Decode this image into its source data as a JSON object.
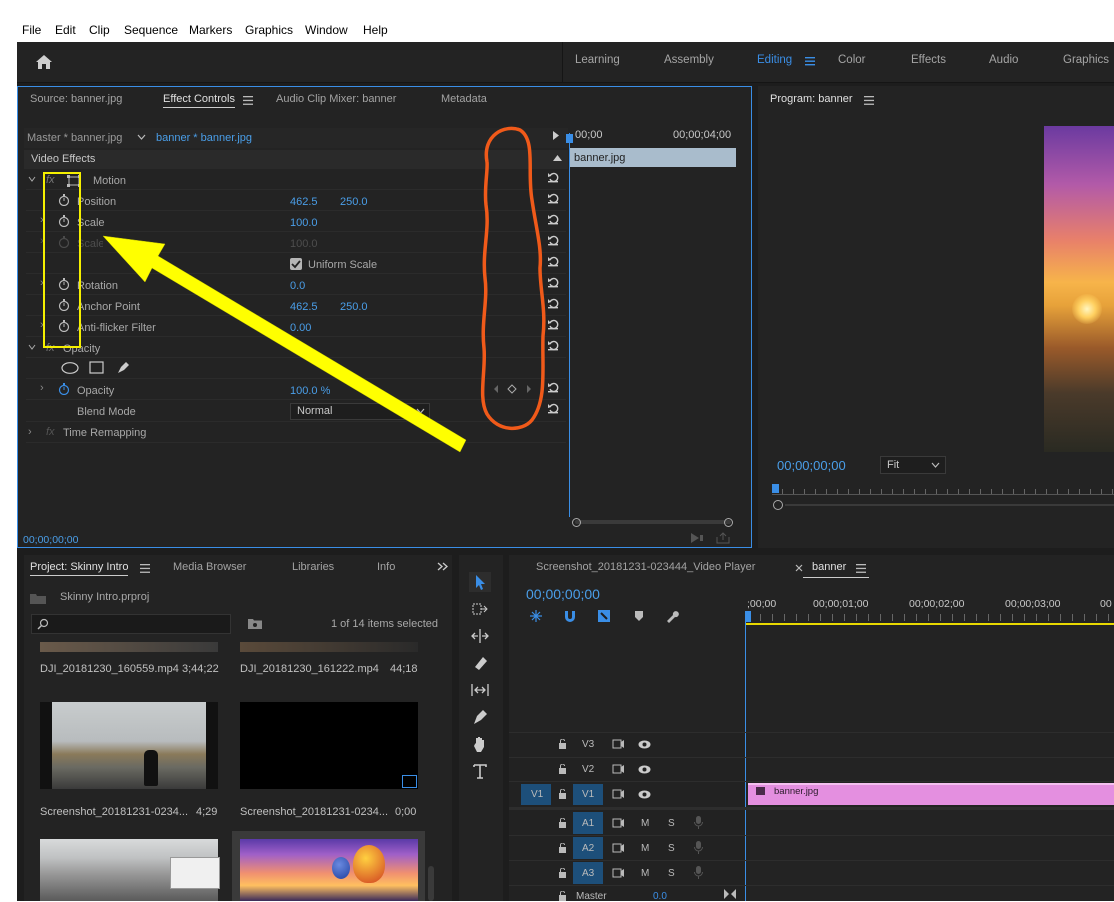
{
  "menu": [
    "File",
    "Edit",
    "Clip",
    "Sequence",
    "Markers",
    "Graphics",
    "Window",
    "Help"
  ],
  "workspaces": {
    "items": [
      {
        "label": "Learning",
        "active": false
      },
      {
        "label": "Assembly",
        "active": false
      },
      {
        "label": "Editing",
        "active": true
      },
      {
        "label": "Color",
        "active": false
      },
      {
        "label": "Effects",
        "active": false
      },
      {
        "label": "Audio",
        "active": false
      },
      {
        "label": "Graphics",
        "active": false
      }
    ]
  },
  "source_tabs": {
    "source": "Source: banner.jpg",
    "effect_controls": "Effect Controls",
    "mixer": "Audio Clip Mixer: banner",
    "metadata": "Metadata"
  },
  "effect_controls": {
    "master": "Master * banner.jpg",
    "clip": "banner * banner.jpg",
    "time_start": "00;00",
    "time_end": "00;00;04;00",
    "clip_bar": "banner.jpg",
    "section": "Video Effects",
    "motion": "Motion",
    "position": {
      "label": "Position",
      "x": "462.5",
      "y": "250.0"
    },
    "scale": {
      "label": "Scale",
      "value": "100.0"
    },
    "scale_width": {
      "label": "Scale Width",
      "value": "100.0"
    },
    "uniform_scale": "Uniform Scale",
    "rotation": {
      "label": "Rotation",
      "value": "0.0"
    },
    "anchor": {
      "label": "Anchor Point",
      "x": "462.5",
      "y": "250.0"
    },
    "antiflicker": {
      "label": "Anti-flicker Filter",
      "value": "0.00"
    },
    "opacity_group": "Opacity",
    "opacity": {
      "label": "Opacity",
      "value": "100.0 %"
    },
    "blend": {
      "label": "Blend Mode",
      "value": "Normal"
    },
    "time_remap": "Time Remapping",
    "timecode": "00;00;00;00"
  },
  "program": {
    "title": "Program: banner",
    "timecode": "00;00;00;00",
    "fit": "Fit"
  },
  "project": {
    "tabs": {
      "project": "Project: Skinny Intro",
      "media": "Media Browser",
      "libraries": "Libraries",
      "info": "Info"
    },
    "file": "Skinny Intro.prproj",
    "selected": "1 of 14 items selected",
    "items": [
      {
        "name": "DJI_20181230_160559.mp4",
        "dur": "3;44;22"
      },
      {
        "name": "DJI_20181230_161222.mp4",
        "dur": "44;18"
      },
      {
        "name": "Screenshot_20181231-0234...",
        "dur": "4;29"
      },
      {
        "name": "Screenshot_20181231-0234...",
        "dur": "0;00"
      }
    ]
  },
  "timeline": {
    "tab1": "Screenshot_20181231-023444_Video Player",
    "tab2": "banner",
    "timecode": "00;00;00;00",
    "ruler": [
      ";00;00",
      "00;00;01;00",
      "00;00;02;00",
      "00;00;03;00",
      "00"
    ],
    "tracks": {
      "v3": "V3",
      "v2": "V2",
      "v1": "V1",
      "src_v1": "V1",
      "a1": "A1",
      "a2": "A2",
      "a3": "A3",
      "m": "M",
      "s": "S",
      "master": "Master",
      "master_val": "0.0"
    },
    "clip": "banner.jpg"
  },
  "colors": {
    "accent": "#3a8ee6",
    "annotation_yellow": "#ffff00",
    "annotation_orange": "#f05a1a",
    "clip_pink": "#e48fe0"
  }
}
